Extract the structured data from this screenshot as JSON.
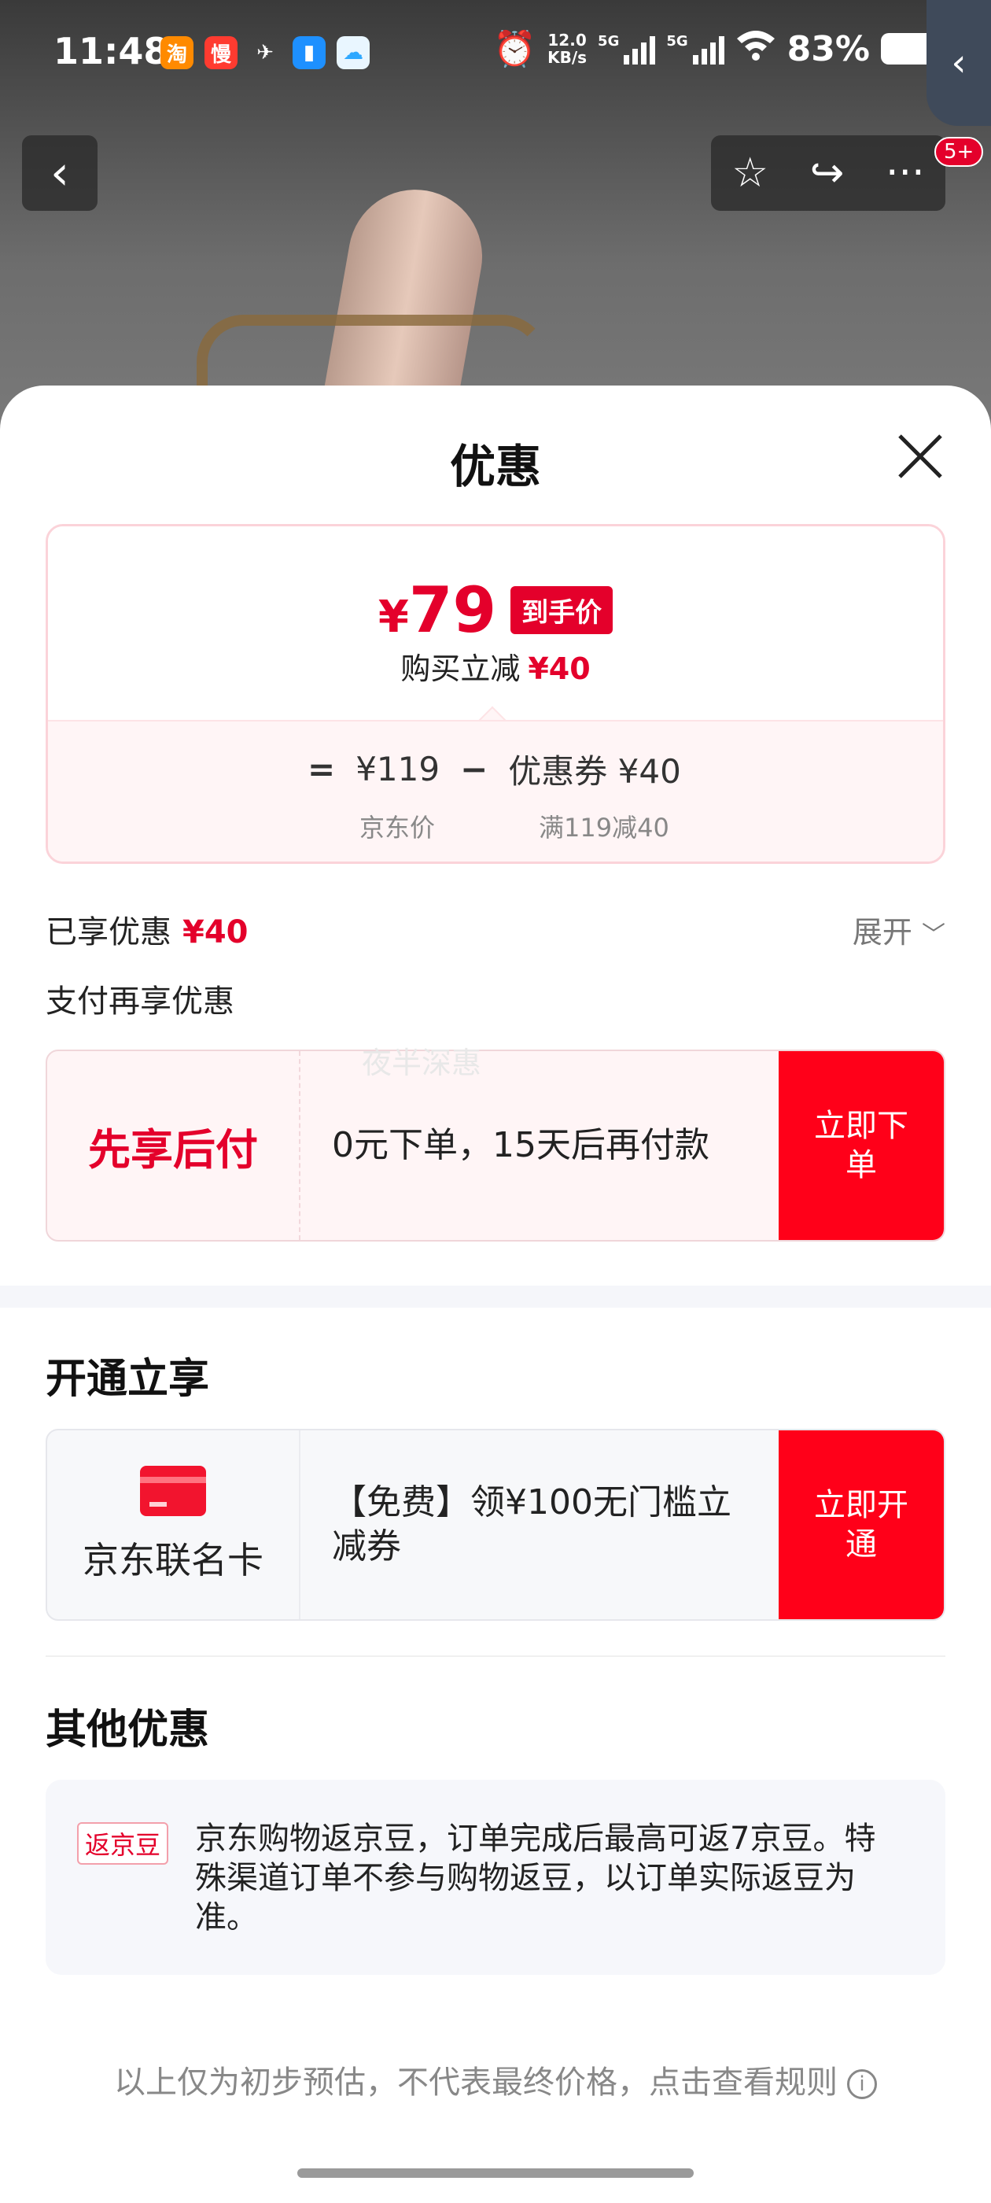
{
  "status_bar": {
    "time": "11:48",
    "app_icons": [
      {
        "name": "taobao-special-icon",
        "glyph": "淘",
        "color": "#ff7a00"
      },
      {
        "name": "man-app-icon",
        "glyph": "慢",
        "color": "#ff3b30"
      },
      {
        "name": "bird-icon",
        "glyph": "✈",
        "color": "#ffffff"
      },
      {
        "name": "phone-manager-icon",
        "glyph": "▮",
        "color": "#1e90ff"
      },
      {
        "name": "ai-cloud-icon",
        "glyph": "☁",
        "color": "#2ea8ff"
      }
    ],
    "net_speed_value": "12.0",
    "net_speed_unit": "KB/s",
    "sig1": "5G",
    "sig2": "5G",
    "battery": "83%"
  },
  "top_nav": {
    "badge": "5+"
  },
  "sheet": {
    "title": "优惠"
  },
  "price_card": {
    "currency": "¥",
    "final_price": "79",
    "tag": "到手价",
    "reduce_label": "购买立减",
    "reduce_amount": "¥40",
    "eq": "=",
    "jd_price": "¥119",
    "minus": "−",
    "coupon": "优惠券 ¥40",
    "jd_price_label": "京东价",
    "coupon_label": "满119减40"
  },
  "enjoyed": {
    "label": "已享优惠",
    "amount": "¥40",
    "expand": "展开"
  },
  "pay_again": "支付再享优惠",
  "bnpl": {
    "title": "先享后付",
    "desc": "0元下单，15天后再付款",
    "button": "立即下单",
    "watermark": "夜半深惠"
  },
  "open_section": {
    "title": "开通立享",
    "card_name": "京东联名卡",
    "desc": "【免费】领¥100无门槛立减券",
    "button": "立即开通"
  },
  "other_section": {
    "title": "其他优惠",
    "tag": "返京豆",
    "text": "京东购物返京豆，订单完成后最高可返7京豆。特殊渠道订单不参与购物返豆，以订单实际返豆为准。"
  },
  "footnote": "以上仅为初步预估，不代表最终价格，点击查看规则",
  "colors": {
    "accent": "#e4002b",
    "button_red": "#ff0019"
  }
}
